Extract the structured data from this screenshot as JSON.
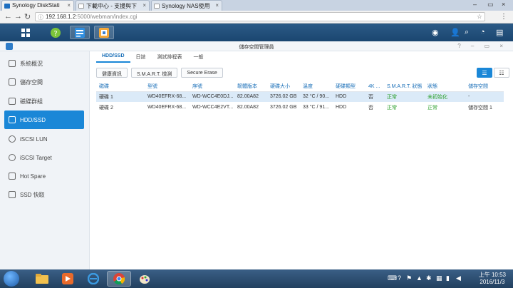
{
  "browser": {
    "tabs": [
      {
        "label": "Synology DiskStati",
        "close": "×"
      },
      {
        "label": "下載中心 - 支援與下",
        "close": "×"
      },
      {
        "label": "Synology NAS使用",
        "close": "×"
      }
    ],
    "url_host": "192.168.1.2",
    "url_rest": ":5000/webman/index.cgi"
  },
  "window": {
    "title": "儲存空間管理員",
    "controls": "? – ▭ ×"
  },
  "sidebar": {
    "items": [
      {
        "label": "系統概況"
      },
      {
        "label": "儲存空間"
      },
      {
        "label": "磁碟群組"
      },
      {
        "label": "HDD/SSD"
      },
      {
        "label": "iSCSI LUN"
      },
      {
        "label": "iSCSI Target"
      },
      {
        "label": "Hot Spare"
      },
      {
        "label": "SSD 快取"
      }
    ]
  },
  "tabs": [
    "HDD/SSD",
    "日誌",
    "測試排程表",
    "一般"
  ],
  "toolbar": [
    "健康資訊",
    "S.M.A.R.T. 檢測",
    "Secure Erase"
  ],
  "table": {
    "headers": [
      "磁碟",
      "型號",
      "序號",
      "韌體版本",
      "硬碟大小",
      "溫度",
      "硬碟類型",
      "4K ...",
      "S.M.A.R.T. 狀態",
      "狀態",
      "儲存空間"
    ],
    "rows": [
      [
        "硬碟 1",
        "WD40EFRX-68...",
        "WD-WCC4E0DJ...",
        "82.00A82",
        "3726.02 GB",
        "32 °C / 90...",
        "HDD",
        "否",
        "正常",
        "未初始化",
        "-"
      ],
      [
        "硬碟 2",
        "WD40EFRX-68...",
        "WD-WCC4E2VT...",
        "82.00A82",
        "3726.02 GB",
        "33 °C / 91...",
        "HDD",
        "否",
        "正常",
        "正常",
        "儲存空間 1"
      ]
    ]
  },
  "clock": {
    "time": "上午 10:53",
    "date": "2016/11/3"
  },
  "colors": {
    "accent": "#1a87d7",
    "ok": "#2ca02c"
  }
}
